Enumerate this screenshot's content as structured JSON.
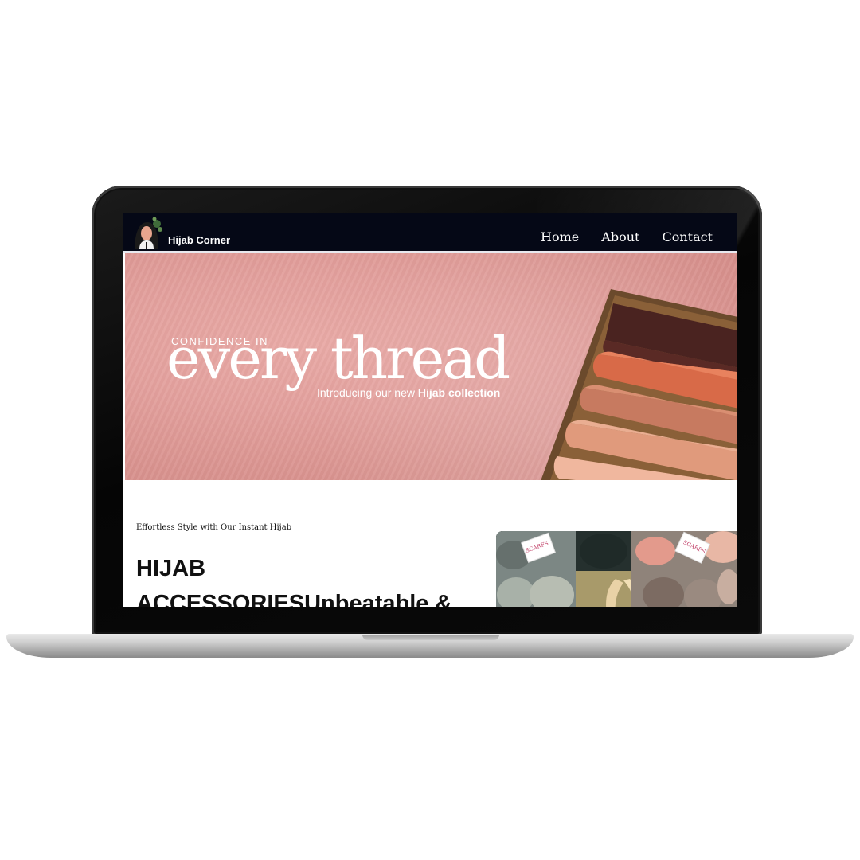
{
  "nav": {
    "brand": "Hijab Corner",
    "links": [
      "Home",
      "About",
      "Contact"
    ]
  },
  "hero": {
    "kicker": "CONFIDENCE IN",
    "headline": "every thread",
    "sub_prefix": "Introducing our new ",
    "sub_bold": "Hijab collection"
  },
  "intro": {
    "tagline": "Effortless Style with Our Instant Hijab",
    "heading": "HIJAB ACCESSORIESUnbeatable &"
  },
  "product_photo": {
    "label_left": "SCARFS",
    "label_right": "SCARFS"
  },
  "icons": {
    "brand_logo": "hijab-woman-logo-icon"
  },
  "colors": {
    "nav_bg": "#050816",
    "hero_bg": "#e3a09d",
    "text": "#111111"
  }
}
